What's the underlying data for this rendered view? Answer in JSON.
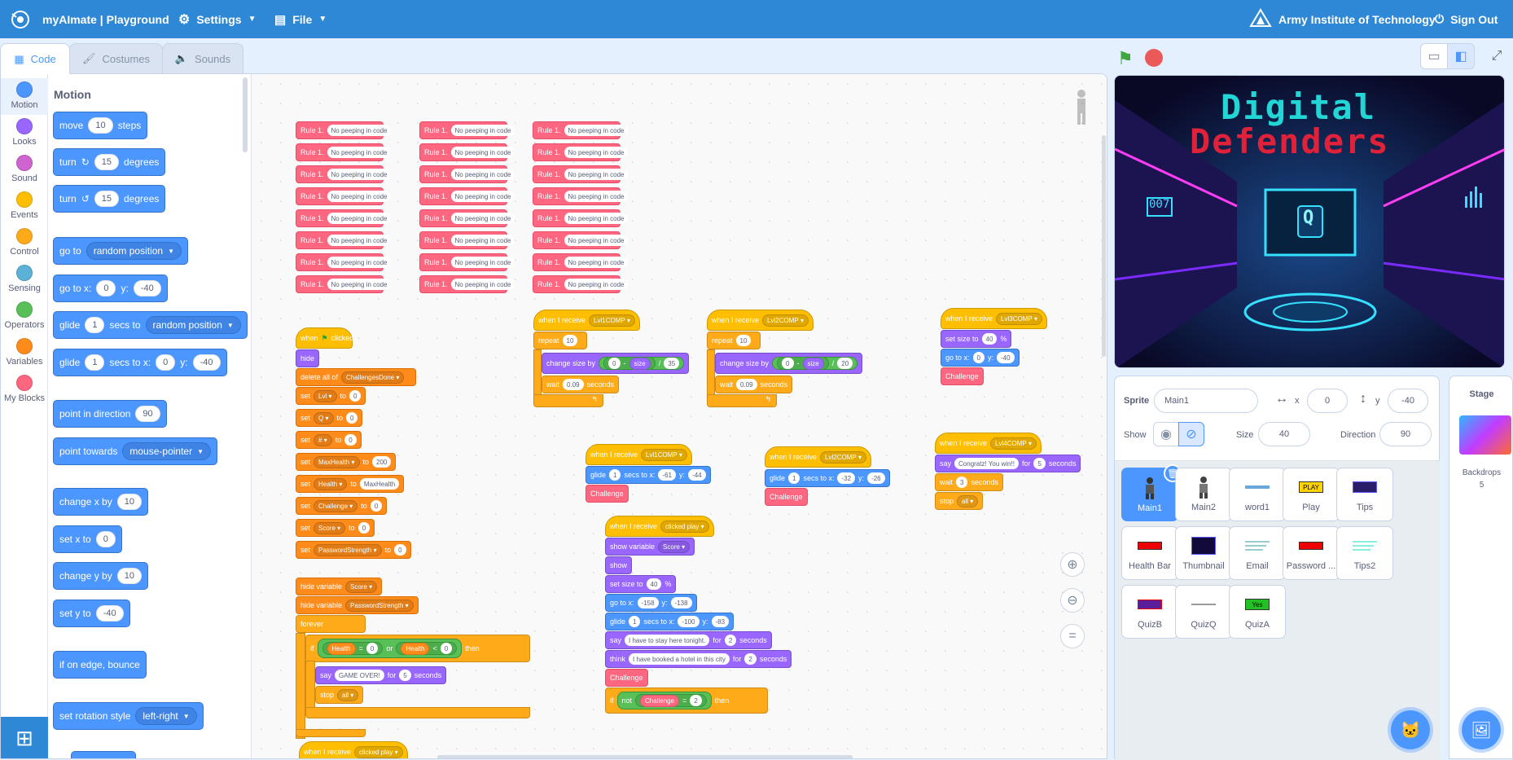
{
  "header": {
    "app_title": "myAImate | Playground",
    "settings_label": "Settings",
    "file_label": "File",
    "org_name": "Army Institute of Technology",
    "signout_label": "Sign Out"
  },
  "tabs": {
    "code": "Code",
    "costumes": "Costumes",
    "sounds": "Sounds"
  },
  "categories": [
    {
      "label": "Motion",
      "color": "#4c97ff"
    },
    {
      "label": "Looks",
      "color": "#9966ff"
    },
    {
      "label": "Sound",
      "color": "#cf63cf"
    },
    {
      "label": "Events",
      "color": "#ffbf00"
    },
    {
      "label": "Control",
      "color": "#ffab19"
    },
    {
      "label": "Sensing",
      "color": "#5cb1d6"
    },
    {
      "label": "Operators",
      "color": "#59c059"
    },
    {
      "label": "Variables",
      "color": "#ff8c1a"
    },
    {
      "label": "My Blocks",
      "color": "#ff6680"
    }
  ],
  "palette": {
    "title": "Motion",
    "move": {
      "a": "move",
      "v": "10",
      "b": "steps"
    },
    "turn_right": {
      "a": "turn",
      "v": "15",
      "b": "degrees"
    },
    "turn_left": {
      "a": "turn",
      "v": "15",
      "b": "degrees"
    },
    "goto": {
      "a": "go to",
      "dd": "random position"
    },
    "gotoxy": {
      "a": "go to x:",
      "x": "0",
      "y_lbl": "y:",
      "y": "-40"
    },
    "glide_to": {
      "a": "glide",
      "v": "1",
      "b": "secs to",
      "dd": "random position"
    },
    "glide_xy": {
      "a": "glide",
      "v": "1",
      "b": "secs to x:",
      "x": "0",
      "y_lbl": "y:",
      "y": "-40"
    },
    "point_dir": {
      "a": "point in direction",
      "v": "90"
    },
    "point_towards": {
      "a": "point towards",
      "dd": "mouse-pointer"
    },
    "change_x": {
      "a": "change x by",
      "v": "10"
    },
    "set_x": {
      "a": "set x to",
      "v": "0"
    },
    "change_y": {
      "a": "change y by",
      "v": "10"
    },
    "set_y": {
      "a": "set y to",
      "v": "-40"
    },
    "bounce": {
      "a": "if on edge, bounce"
    },
    "rot_style": {
      "a": "set rotation style",
      "dd": "left-right"
    }
  },
  "script": {
    "rule_label": "Rule 1.",
    "rule_text": "No peeping in code",
    "when_flag": {
      "a": "when",
      "b": "clicked"
    },
    "hide": "hide",
    "show": "show",
    "delete_all": {
      "a": "delete all of",
      "dd": "ChallengesDone"
    },
    "set_word": "set",
    "to_word": "to",
    "sets": [
      {
        "var": "Lvl",
        "val": "0"
      },
      {
        "var": "Q",
        "val": "0"
      },
      {
        "var": "#",
        "val": "0"
      },
      {
        "var": "MaxHealth",
        "val": "200"
      },
      {
        "var": "Health",
        "val": "MaxHealth"
      },
      {
        "var": "Challenge",
        "val": "0"
      },
      {
        "var": "Score",
        "val": "0"
      },
      {
        "var": "PasswordStrength",
        "val": "0"
      }
    ],
    "hide_var": "hide variable",
    "hide_var1": "Score",
    "hide_var2": "PasswordStrength",
    "forever": "forever",
    "if_word": "if",
    "then_word": "then",
    "or_word": "or",
    "health": "Health",
    "eq": "=",
    "lt": "<",
    "zero": "0",
    "say": "say",
    "game_over": "GAME OVER!",
    "for_word": "for",
    "five": "5",
    "seconds": "seconds",
    "stop": "stop",
    "all": "all",
    "when_receive": "when I receive",
    "clicked_play": "clicked play",
    "lvl1": "Lvl1COMP",
    "lvl2": "Lvl2COMP",
    "lvl3": "Lvl3COMP",
    "lvl4": "Lvl4COMP",
    "repeat": "repeat",
    "ten": "10",
    "change_size": "change size by",
    "size": "size",
    "minus": "-",
    "div": "/",
    "v35": "35",
    "v20": "20",
    "wait": "wait",
    "v009": "0.09",
    "glide": "glide",
    "one": "1",
    "secs_to_x": "secs to x:",
    "y_lbl": "y:",
    "g1x": "-61",
    "g1y": "-44",
    "g2x": "-32",
    "g2y": "-26",
    "challenge": "Challenge",
    "set_size": "set size to",
    "forty": "40",
    "pct": "%",
    "goto_x": "go to x:",
    "zero_x": "0",
    "neg40": "-40",
    "congrats": "Congratz! You win!!",
    "three": "3",
    "show_var": "show variable",
    "score": "Score",
    "gx": "-158",
    "gy": "-138",
    "glx": "-100",
    "gly": "-83",
    "say_stay": "I have to stay here tonight.",
    "two": "2",
    "think": "think",
    "think_text": "I have booked a hotel in this city",
    "not_word": "not"
  },
  "stage_view": {
    "title1": "Digital",
    "title2": "Defenders",
    "badge": "Q",
    "counter": "007"
  },
  "sprite_info": {
    "sprite_label": "Sprite",
    "sprite_name": "Main1",
    "x_label": "x",
    "x": "0",
    "y_label": "y",
    "y": "-40",
    "show_label": "Show",
    "size_label": "Size",
    "size": "40",
    "direction_label": "Direction",
    "direction": "90"
  },
  "sprites": [
    "Main1",
    "Main2",
    "word1",
    "Play",
    "Tips",
    "Health Bar",
    "Thumbnail",
    "Email",
    "Password ...",
    "Tips2",
    "QuizB",
    "QuizQ",
    "QuizA"
  ],
  "sprite_thumbs": {
    "play": "PLAY",
    "yes": "Yes"
  },
  "stage_panel": {
    "title": "Stage",
    "backdrops_label": "Backdrops",
    "backdrops_count": "5"
  }
}
